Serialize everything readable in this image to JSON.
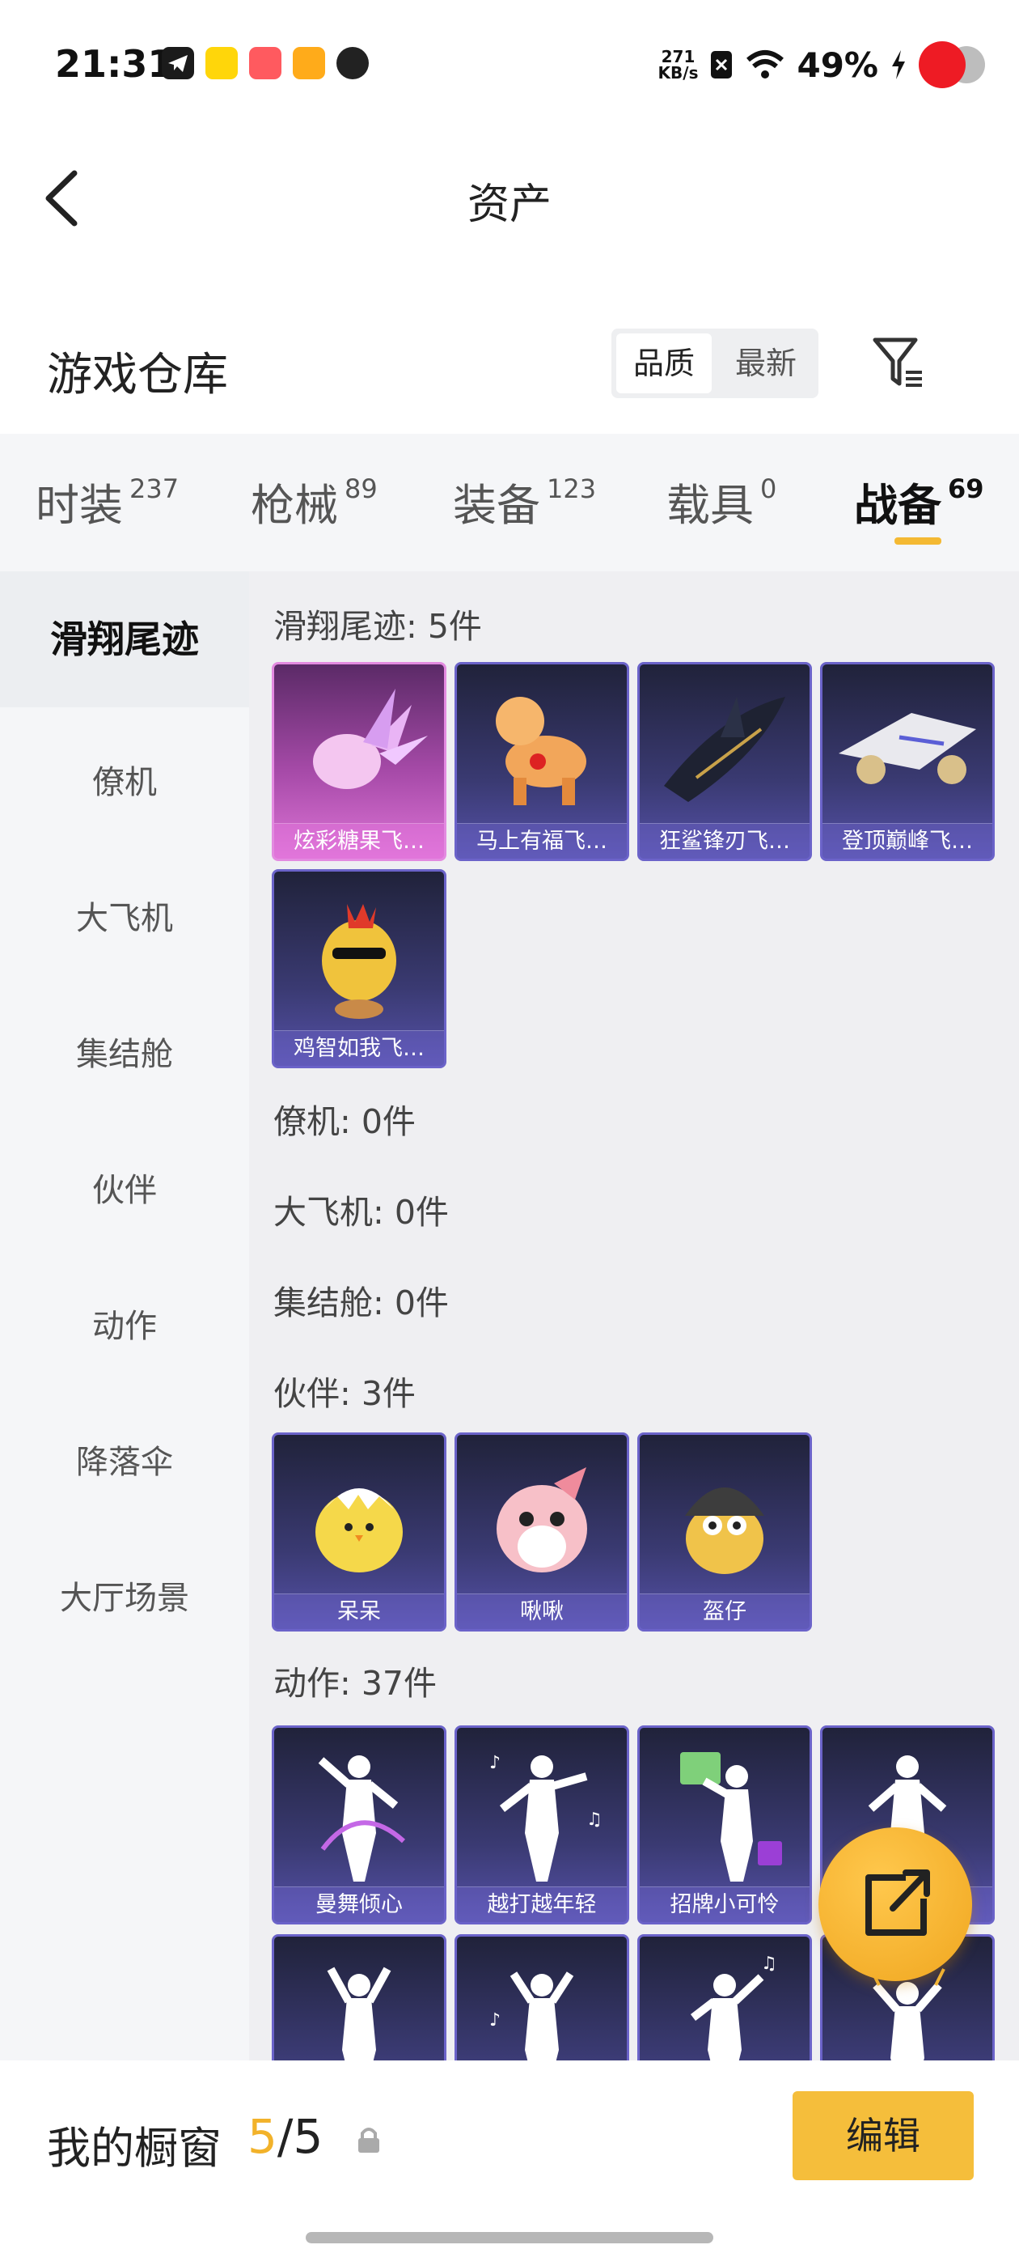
{
  "status_bar": {
    "time": "21:31",
    "net_speed_value": "271",
    "net_speed_unit": "KB/s",
    "battery": "49%",
    "app_icons": [
      "telegram-icon",
      "yellow-app-icon",
      "red-app-icon",
      "orange-app-icon",
      "q-app-icon"
    ]
  },
  "header": {
    "title": "资产"
  },
  "warehouse": {
    "title": "游戏仓库",
    "sort_options": [
      "品质",
      "最新"
    ],
    "active_sort": "品质"
  },
  "tabs": [
    {
      "label": "时装",
      "count": "237"
    },
    {
      "label": "枪械",
      "count": "89"
    },
    {
      "label": "装备",
      "count": "123"
    },
    {
      "label": "载具",
      "count": "0"
    },
    {
      "label": "战备",
      "count": "69",
      "active": true
    }
  ],
  "sidebar": {
    "items": [
      "滑翔尾迹",
      "僚机",
      "大飞机",
      "集结舱",
      "伙伴",
      "动作",
      "降落伞",
      "大厅场景"
    ],
    "active": "滑翔尾迹"
  },
  "sections": {
    "trail": {
      "title": "滑翔尾迹: 5件",
      "items": [
        "炫彩糖果飞…",
        "马上有福飞…",
        "狂鲨锋刃飞…",
        "登顶巅峰飞…",
        "鸡智如我飞…"
      ]
    },
    "wingman": {
      "title": "僚机: 0件"
    },
    "plane": {
      "title": "大飞机: 0件"
    },
    "pod": {
      "title": "集结舱: 0件"
    },
    "companion": {
      "title": "伙伴: 3件",
      "items": [
        "呆呆",
        "啾啾",
        "盔仔"
      ]
    },
    "emote": {
      "title": "动作: 37件",
      "items": [
        "曼舞倾心",
        "越打越年轻",
        "招牌小可怜",
        "",
        "",
        "",
        "",
        ""
      ]
    }
  },
  "showcase": {
    "label": "我的橱窗",
    "current": "5",
    "separator": "/",
    "total": "5",
    "edit_label": "编辑"
  },
  "colors": {
    "accent": "#f5be3b",
    "tab_underline": "#f4b933",
    "card_purple": "#3a3a72",
    "card_pink": "#a64aa8"
  }
}
